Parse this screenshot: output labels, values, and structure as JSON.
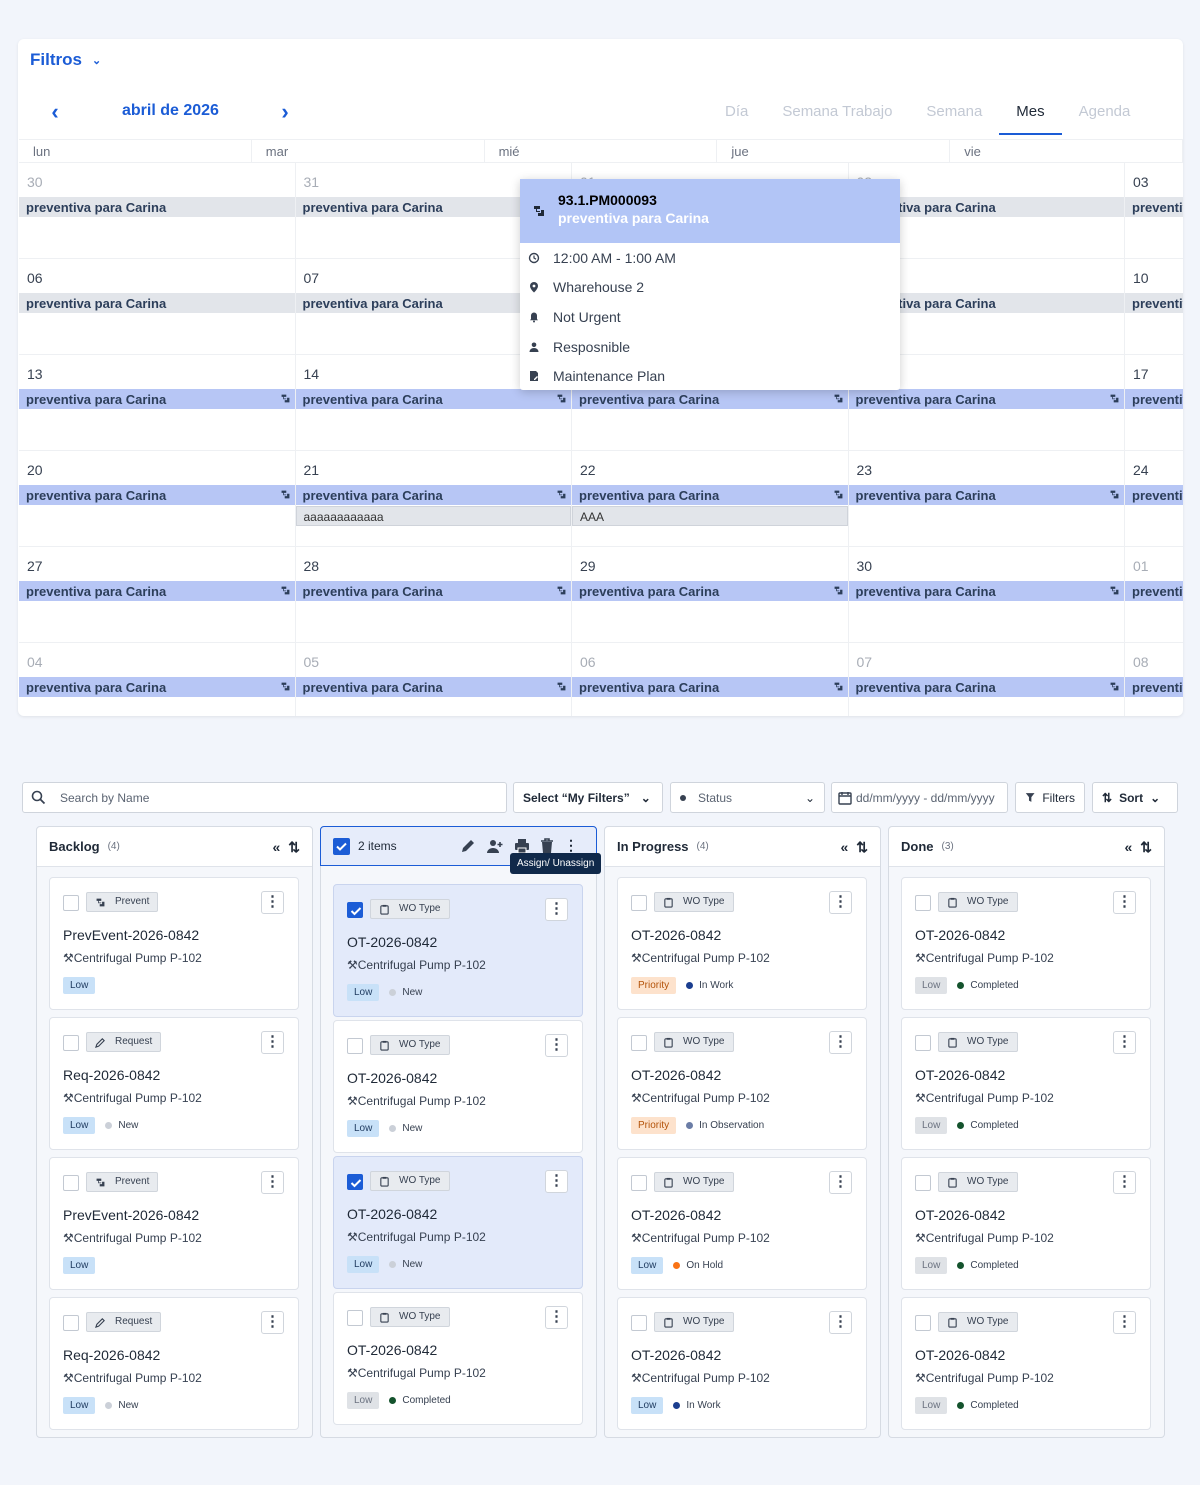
{
  "calendar": {
    "filters_label": "Filtros",
    "month": "abril de 2026",
    "views": [
      {
        "label": "Día",
        "active": false
      },
      {
        "label": "Semana Trabajo",
        "active": false
      },
      {
        "label": "Semana",
        "active": false
      },
      {
        "label": "Mes",
        "active": true
      },
      {
        "label": "Agenda",
        "active": false
      }
    ],
    "weekdays": [
      "lun",
      "mar",
      "mié",
      "jue",
      "vie"
    ],
    "event_title": "preventiva para Carina",
    "weeks": [
      {
        "days": [
          "30",
          "31",
          "01",
          "02",
          "03"
        ],
        "muted": [
          true,
          true,
          true,
          true,
          false
        ],
        "style": "gray"
      },
      {
        "days": [
          "06",
          "07",
          "08",
          "09",
          "10"
        ],
        "muted": [
          false,
          false,
          false,
          false,
          false
        ],
        "style": "gray"
      },
      {
        "days": [
          "13",
          "14",
          "15",
          "16",
          "17"
        ],
        "muted": [
          false,
          false,
          false,
          false,
          false
        ],
        "style": "blue"
      },
      {
        "days": [
          "20",
          "21",
          "22",
          "23",
          "24"
        ],
        "muted": [
          false,
          false,
          false,
          false,
          false
        ],
        "style": "blue"
      },
      {
        "days": [
          "27",
          "28",
          "29",
          "30",
          "01"
        ],
        "muted": [
          false,
          false,
          false,
          false,
          true
        ],
        "style": "blue"
      },
      {
        "days": [
          "04",
          "05",
          "06",
          "07",
          "08"
        ],
        "muted": [
          true,
          true,
          true,
          true,
          true
        ],
        "style": "blue"
      }
    ],
    "extra_events": [
      {
        "week": 3,
        "day": 1,
        "label": "aaaaaaaaaaaa"
      },
      {
        "week": 3,
        "day": 2,
        "label": "AAA"
      }
    ],
    "popup": {
      "id": "93.1.PM000093",
      "name": "preventiva para Carina",
      "time": "12:00 AM - 1:00 AM",
      "location": "Wharehouse 2",
      "urgency": "Not Urgent",
      "responsible": "Resposnible",
      "plan": "Maintenance Plan"
    }
  },
  "kanban": {
    "search_placeholder": "Search by Name",
    "my_filters": "Select “My Filters”",
    "status": "Status",
    "date_range": "dd/mm/yyyy - dd/mm/yyyy",
    "filters": "Filters",
    "sort": "Sort",
    "selection_label": "2 items",
    "tooltip": "Assign/ Unassign",
    "asset": "Centrifugal Pump P-102",
    "columns": [
      {
        "name": "Backlog",
        "count": "(4)",
        "cards": [
          {
            "tag": "Prevent",
            "title": "PrevEvent-2026-0842",
            "priority": "Low",
            "status": ""
          },
          {
            "tag": "Request",
            "title": "Req-2026-0842",
            "priority": "Low",
            "status": "New"
          },
          {
            "tag": "Prevent",
            "title": "PrevEvent-2026-0842",
            "priority": "Low",
            "status": ""
          },
          {
            "tag": "Request",
            "title": "Req-2026-0842",
            "priority": "Low",
            "status": "New"
          }
        ]
      },
      {
        "name": "",
        "count": "",
        "cards": [
          {
            "tag": "WO Type",
            "title": "OT-2026-0842",
            "priority": "Low",
            "status": "New",
            "selected": true
          },
          {
            "tag": "WO Type",
            "title": "OT-2026-0842",
            "priority": "Low",
            "status": "New"
          },
          {
            "tag": "WO Type",
            "title": "OT-2026-0842",
            "priority": "Low",
            "status": "New",
            "selected": true
          },
          {
            "tag": "WO Type",
            "title": "OT-2026-0842",
            "priority": "Low",
            "status": "Completed"
          }
        ]
      },
      {
        "name": "In Progress",
        "count": "(4)",
        "cards": [
          {
            "tag": "WO Type",
            "title": "OT-2026-0842",
            "priority": "Priority",
            "status": "In Work"
          },
          {
            "tag": "WO Type",
            "title": "OT-2026-0842",
            "priority": "Priority",
            "status": "In Observation"
          },
          {
            "tag": "WO Type",
            "title": "OT-2026-0842",
            "priority": "Low",
            "status": "On Hold"
          },
          {
            "tag": "WO Type",
            "title": "OT-2026-0842",
            "priority": "Low",
            "status": "In Work"
          }
        ]
      },
      {
        "name": "Done",
        "count": "(3)",
        "cards": [
          {
            "tag": "WO Type",
            "title": "OT-2026-0842",
            "priority": "Low",
            "status": "Completed"
          },
          {
            "tag": "WO Type",
            "title": "OT-2026-0842",
            "priority": "Low",
            "status": "Completed"
          },
          {
            "tag": "WO Type",
            "title": "OT-2026-0842",
            "priority": "Low",
            "status": "Completed"
          },
          {
            "tag": "WO Type",
            "title": "OT-2026-0842",
            "priority": "Low",
            "status": "Completed"
          }
        ]
      }
    ]
  },
  "colors": {
    "accent": "#1b5cd6",
    "event_blue": "#b7c6f5",
    "event_gray": "#e2e5ea",
    "in_work": "#1b3e8f",
    "on_hold": "#f97316",
    "completed": "#14532d",
    "new": "#cbd0d8"
  }
}
